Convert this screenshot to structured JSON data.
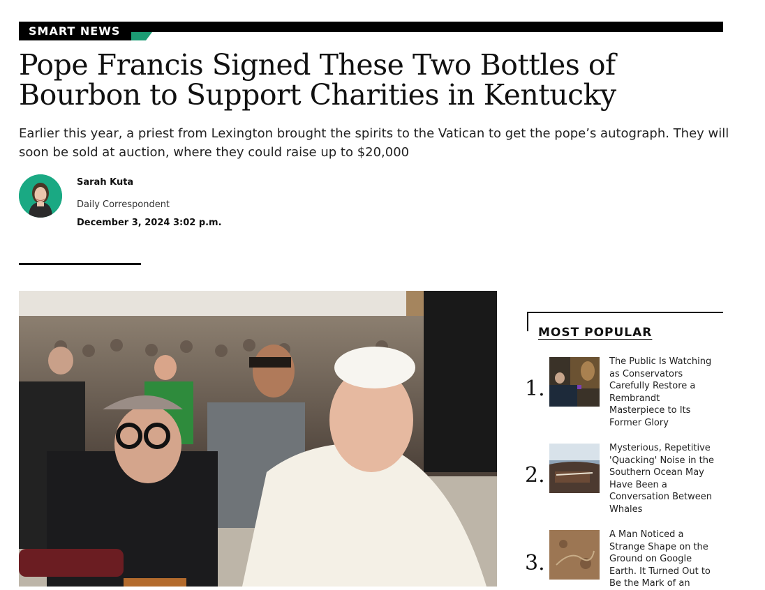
{
  "section": {
    "kicker": "SMART NEWS",
    "accent_color": "#1c9b73"
  },
  "article": {
    "title": "Pope Francis Signed These Two Bottles of Bourbon to Support Charities in Kentucky",
    "dek": "Earlier this year, a priest from Lexington brought the spirits to the Vatican to get the pope’s autograph. They will soon be sold at auction, where they could raise up to $20,000",
    "author": {
      "name": "Sarah Kuta",
      "role": "Daily Correspondent",
      "avatar_bg": "#1aa983"
    },
    "date": "December 3, 2024 3:02 p.m."
  },
  "most_popular": {
    "heading": "MOST POPULAR",
    "items": [
      {
        "rank": "1.",
        "title": "The Public Is Watching as Conservators Carefully Restore a Rembrandt Masterpiece to Its Former Glory",
        "thumb": "conservator-painting-image"
      },
      {
        "rank": "2.",
        "title": "Mysterious, Repetitive 'Quacking' Noise in the Southern Ocean May Have Been a Conversation Between Whales",
        "thumb": "ocean-whales-image"
      },
      {
        "rank": "3.",
        "title": "A Man Noticed a Strange Shape on the Ground on Google Earth. It Turned Out to Be the Mark of an",
        "thumb": "aerial-ground-image"
      }
    ]
  }
}
